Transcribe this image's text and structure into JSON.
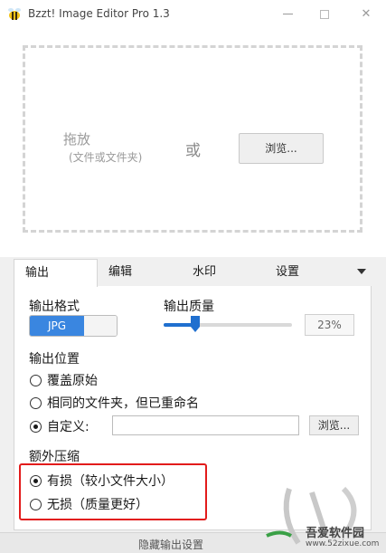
{
  "window": {
    "title": "Bzzt! Image Editor Pro 1.3",
    "controls": {
      "minimize": "—",
      "maximize": "☐",
      "close": "✕"
    }
  },
  "dropzone": {
    "drag_label": "拖放",
    "drag_sublabel": "(文件或文件夹)",
    "or_label": "或",
    "browse_label": "浏览..."
  },
  "tabs": [
    {
      "label": "输出",
      "active": true
    },
    {
      "label": "编辑",
      "active": false
    },
    {
      "label": "水印",
      "active": false
    },
    {
      "label": "设置",
      "active": false
    }
  ],
  "output": {
    "format_label": "输出格式",
    "format_value": "JPG",
    "quality_label": "输出质量",
    "quality_value": "23%",
    "quality_fraction": 0.23,
    "location_label": "输出位置",
    "location_options": [
      {
        "label": "覆盖原始",
        "checked": false
      },
      {
        "label": "相同的文件夹，但已重命名",
        "checked": false
      },
      {
        "label": "自定义:",
        "checked": true
      }
    ],
    "custom_path_value": "",
    "custom_browse_label": "浏览...",
    "compression_label": "额外压缩",
    "compression_options": [
      {
        "label": "有损（较小文件大小）",
        "checked": true
      },
      {
        "label": "无损（质量更好）",
        "checked": false
      }
    ]
  },
  "footer": {
    "hide_settings_label": "隐藏输出设置"
  },
  "watermark": {
    "line1": "吾爱软件园",
    "line2": "www.52zixue.com"
  },
  "colors": {
    "accent": "#3a86e0",
    "highlight_border": "#e21b1b",
    "panel_bg": "#ffffff",
    "window_bg": "#f0f0f0"
  },
  "icons": {
    "app": "bee-icon",
    "tab_menu": "chevron-down-icon"
  }
}
